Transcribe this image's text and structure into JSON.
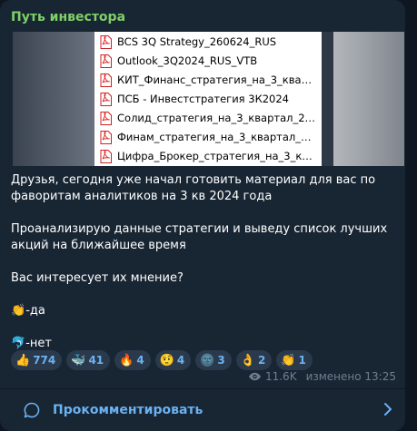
{
  "channel": {
    "name": "Путь инвестора"
  },
  "media": {
    "files": [
      "BCS 3Q Strategy_260624_RUS",
      "Outlook_3Q2024_RUS_VTB",
      "КИТ_Финанс_стратегия_на_3_квартал_2...",
      "ПСБ - Инвестстратегия 3К2024",
      "Солид_стратегия_на_3_квартал_2024_го...",
      "Финам_стратегия_на_3_квартал_2024_г...",
      "Цифра_Брокер_стратегия_на_3_квартал..."
    ]
  },
  "post": {
    "line1": "Друзья, сегодня уже начал готовить материал для вас по",
    "line2": "фаворитам аналитиков на 3 кв 2024 года",
    "line3": "Проанализирую данные стратегии и выведу список лучших",
    "line4": "акций на ближайшее время",
    "line5": "Вас интересует их мнение?",
    "vote_yes_emoji": "👏",
    "vote_yes": "-да",
    "vote_no_emoji": "🐬",
    "vote_no": "-нет"
  },
  "reactions": [
    {
      "emoji": "👍",
      "count": "774"
    },
    {
      "emoji": "🐳",
      "count": "41"
    },
    {
      "emoji": "🔥",
      "count": "4"
    },
    {
      "emoji": "🤨",
      "count": "4"
    },
    {
      "emoji": "🌚",
      "count": "3"
    },
    {
      "emoji": "👌",
      "count": "2"
    },
    {
      "emoji": "👏",
      "count": "1"
    }
  ],
  "meta": {
    "views": "11.6K",
    "edited": "изменено 13:25"
  },
  "comments": {
    "label": "Прокомментировать"
  },
  "colors": {
    "accent": "#6ab2f2",
    "channel": "#7fd068",
    "bubble": "#182533"
  }
}
